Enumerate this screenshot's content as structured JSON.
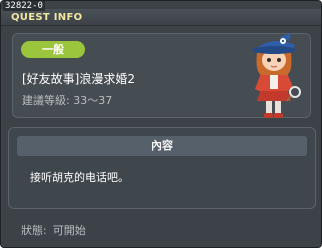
{
  "window": {
    "quest_id": "32822-0",
    "title": "QUEST INFO"
  },
  "quest": {
    "category": "一般",
    "title": "[好友故事]浪漫求婚2",
    "level_label": "建議等級:",
    "level_range": "33～37"
  },
  "content": {
    "header": "內容",
    "description": "接听胡克的电话吧。"
  },
  "status": {
    "label": "狀態:",
    "value": "可開始"
  },
  "colors": {
    "badge_green": "#9bc53c",
    "title_yellow": "#f2e7a0",
    "panel_bg": "#454c52"
  },
  "icons": {
    "portrait": "character-portrait"
  }
}
